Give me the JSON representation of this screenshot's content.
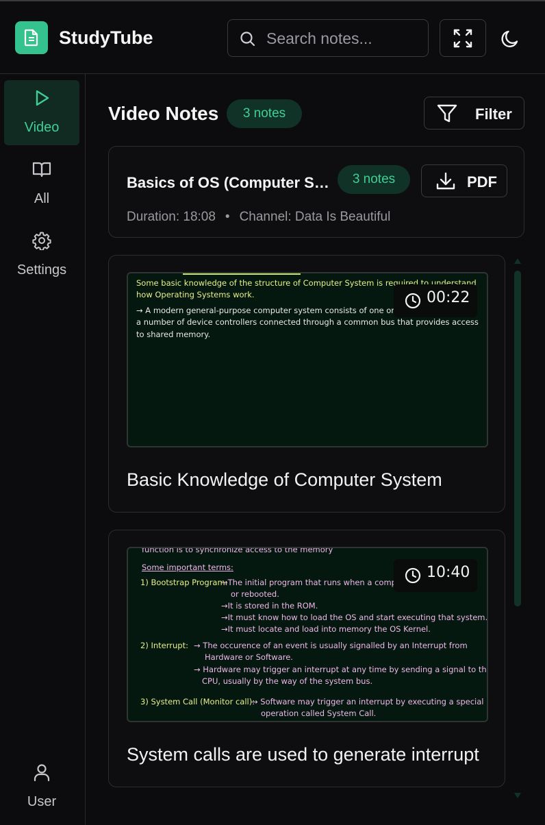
{
  "app": {
    "title": "StudyTube"
  },
  "search": {
    "placeholder": "Search notes..."
  },
  "sidebar": {
    "items": [
      {
        "label": "Video",
        "icon": "play-icon",
        "active": true
      },
      {
        "label": "All",
        "icon": "book-icon",
        "active": false
      },
      {
        "label": "Settings",
        "icon": "gear-icon",
        "active": false
      }
    ],
    "user_label": "User"
  },
  "main": {
    "title": "Video Notes",
    "count_badge": "3 notes",
    "filter_label": "Filter"
  },
  "video": {
    "title": "Basics of OS (Computer System Organization)",
    "title_shown": "Basics of OS (Computer Sy...",
    "notes_badge": "3 notes",
    "pdf_label": "PDF",
    "duration": "Duration: 18:08",
    "separator": "•",
    "channel": "Channel: Data Is Beautiful"
  },
  "notes": [
    {
      "timestamp": "00:22",
      "title": "Basic Knowledge of Computer System",
      "thumb_lines": [
        "Some basic knowledge of the structure of Computer System is required to understand",
        "how Operating Systems work.",
        "→ A modern general-purpose computer system consists of one or more CPUs and",
        "a number of device controllers connected through a common bus that provides access",
        "to shared memory."
      ]
    },
    {
      "timestamp": "10:40",
      "title": "System calls are used to generate interrupt",
      "thumb_lines": [
        "function is to synchronize access to the memory",
        "Some important terms:",
        "1) Bootstrap Program:",
        "→The initial program that runs when a computer is powered up",
        "or rebooted.",
        "→It is stored in the ROM.",
        "→It must know how to load the OS and start executing that system.",
        "→It must locate and load into memory the OS Kernel.",
        "2) Interrupt:",
        "→ The occurence of an event is usually signalled by an Interrupt from",
        "Hardware or Software.",
        "→ Hardware may trigger an interrupt at any time by sending a signal to the",
        "CPU, usually by the way of the system bus.",
        "3) System Call (Monitor call):",
        "→ Software may trigger an interrupt by executing a special",
        "operation called System Call."
      ]
    }
  ],
  "colors": {
    "accent": "#34c38f",
    "accent_text": "#3fcf97",
    "badge_bg": "#113327",
    "background": "#0c0c0e",
    "thumb_bg": "#04180f",
    "thumb_text_yellow": "#e8f08a",
    "thumb_text_pink": "#f0b8e8"
  }
}
